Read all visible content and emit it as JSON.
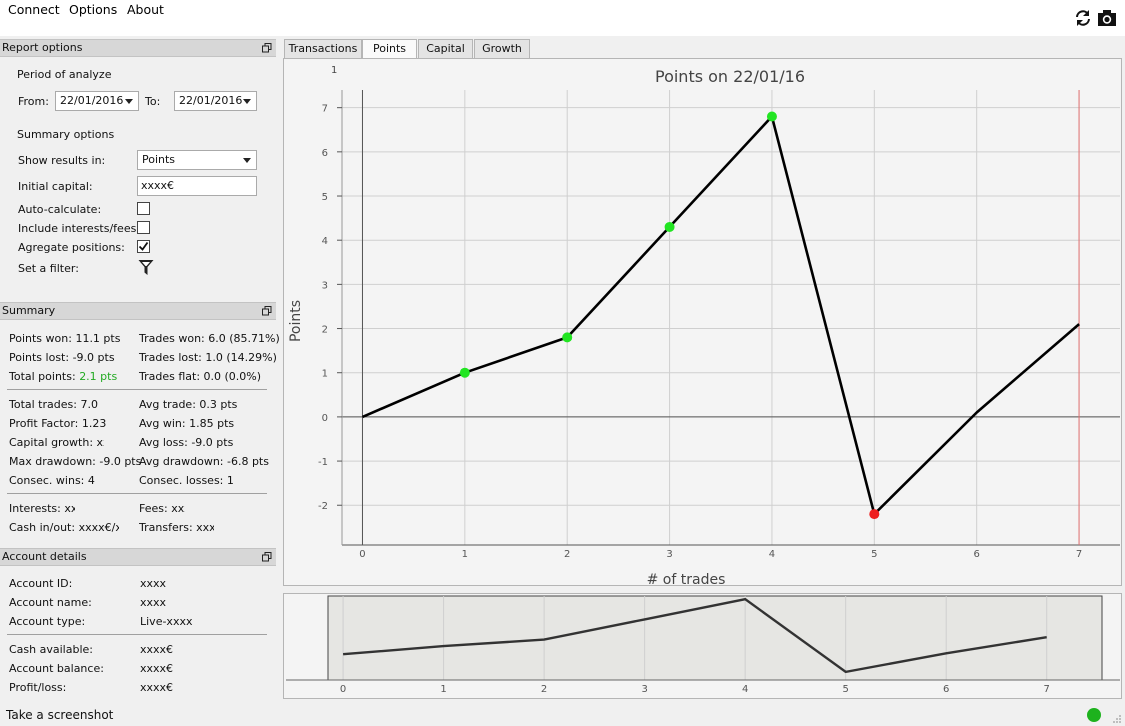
{
  "menu": {
    "connect": "Connect",
    "options": "Options",
    "about": "About"
  },
  "toolbar": {
    "refresh_icon": "refresh-icon",
    "camera_icon": "camera-icon"
  },
  "report_options": {
    "title": "Report options",
    "period_label": "Period of analyze",
    "from_label": "From:",
    "from_value": "22/01/2016",
    "to_label": "To:",
    "to_value": "22/01/2016",
    "summary_options_label": "Summary options",
    "show_results_label": "Show results in:",
    "show_results_value": "Points",
    "initial_capital_label": "Initial capital:",
    "initial_capital_value": "xxxx€",
    "auto_calculate_label": "Auto-calculate:",
    "auto_calculate_checked": false,
    "include_interests_label": "Include interests/fees:",
    "include_interests_checked": false,
    "aggregate_label": "Agregate positions:",
    "aggregate_checked": true,
    "filter_label": "Set a filter:"
  },
  "summary": {
    "title": "Summary",
    "points_won": "Points won: 11.1 pts",
    "points_lost": "Points lost: -9.0 pts",
    "total_points_label": "Total points:",
    "total_points_value": "2.1 pts",
    "trades_won": "Trades won: 6.0 (85.71%)",
    "trades_lost": "Trades lost: 1.0 (14.29%)",
    "trades_flat": "Trades flat: 0.0 (0.0%)",
    "total_trades": "Total trades: 7.0",
    "profit_factor": "Profit Factor: 1.23",
    "capital_growth": "Capital growth: xx%",
    "max_drawdown": "Max drawdown: -9.0 pts",
    "consec_wins": "Consec. wins: 4",
    "avg_trade": "Avg trade: 0.3 pts",
    "avg_win": "Avg win: 1.85 pts",
    "avg_loss": "Avg loss: -9.0 pts",
    "avg_drawdown": "Avg drawdown: -6.8 pts",
    "consec_losses": "Consec. losses: 1",
    "interests": "Interests: xxx",
    "fees": "Fees: xxx",
    "cash_in_out": "Cash in/out: xxxx€/xxx",
    "transfers": "Transfers: xxxx"
  },
  "account": {
    "title": "Account details",
    "id_label": "Account ID:",
    "id_value": "xxxx",
    "name_label": "Account name:",
    "name_value": "xxxx",
    "type_label": "Account type:",
    "type_value": "Live-xxxx",
    "cash_label": "Cash available:",
    "cash_value": "xxxx€",
    "balance_label": "Account balance:",
    "balance_value": "xxxx€",
    "pl_label": "Profit/loss:",
    "pl_value": "xxxx€"
  },
  "tabs": [
    "Transactions",
    "Points",
    "Capital",
    "Growth"
  ],
  "active_tab": 1,
  "status": {
    "text": "Take a screenshot",
    "indicator_color": "#1db21d"
  },
  "colors": {
    "win": "#22e522",
    "loss": "#ee2020",
    "line": "#000000",
    "total_points": "#22aa22"
  },
  "chart_data": {
    "type": "line",
    "title": "Points on 22/01/16",
    "xlabel": "# of trades",
    "ylabel": "Points",
    "x": [
      0,
      1,
      2,
      3,
      4,
      5,
      6,
      7
    ],
    "y": [
      0,
      1,
      1.8,
      4.3,
      6.8,
      -2.2,
      0.1,
      2.1
    ],
    "markers": [
      {
        "x": 1,
        "y": 1,
        "kind": "win"
      },
      {
        "x": 2,
        "y": 1.8,
        "kind": "win"
      },
      {
        "x": 3,
        "y": 4.3,
        "kind": "win"
      },
      {
        "x": 4,
        "y": 6.8,
        "kind": "win"
      },
      {
        "x": 5,
        "y": -2.2,
        "kind": "loss"
      }
    ],
    "xlim": [
      -0.2,
      7.4
    ],
    "ylim": [
      -2.9,
      7.4
    ],
    "xticks": [
      0,
      1,
      2,
      3,
      4,
      5,
      6,
      7
    ],
    "yticks": [
      -2,
      -1,
      0,
      1,
      2,
      3,
      4,
      5,
      6,
      7
    ],
    "vline_x": 7,
    "grid": true,
    "corner_tick": "1"
  },
  "mini_chart": {
    "x": [
      0,
      1,
      2,
      3,
      4,
      5,
      6,
      7
    ],
    "y": [
      0,
      1,
      1.8,
      4.3,
      6.8,
      -2.2,
      0.1,
      2.1
    ],
    "xticks": [
      0,
      1,
      2,
      3,
      4,
      5,
      6,
      7
    ],
    "corner_tick": "1"
  }
}
